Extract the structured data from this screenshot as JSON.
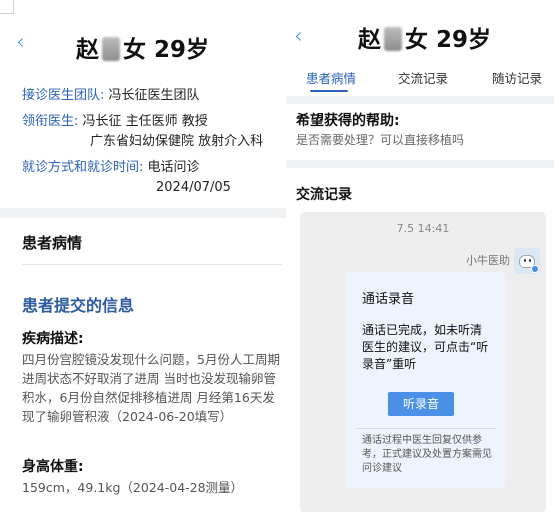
{
  "left": {
    "header": {
      "name_prefix": "赵",
      "title_rest": "女 29岁"
    },
    "team_label": "接诊医生团队:",
    "team_value": "冯长征医生团队",
    "lead_label": "领衔医生:",
    "lead_value": "冯长征 主任医师 教授",
    "lead_value2": "广东省妇幼保健院 放射介入科",
    "visit_label": "就诊方式和就诊时间:",
    "visit_value": "电话问诊",
    "visit_date": "2024/07/05",
    "section_title": "患者病情",
    "submitted_title": "患者提交的信息",
    "desc_title": "疾病描述:",
    "desc_text": "四月份宫腔镜没发现什么问题，5月份人工周期进周状态不好取消了进周 当时也没发现输卵管积水，6月份自然促排移植进周 月经第16天发现了输卵管积液（2024-06-20填写）",
    "hw_title": "身高体重:",
    "hw_text": "159cm，49.1kg（2024-04-28测量）"
  },
  "right": {
    "header": {
      "name_prefix": "赵",
      "title_rest": "女 29岁"
    },
    "tabs": [
      "患者病情",
      "交流记录",
      "随访记录"
    ],
    "help_title": "希望获得的帮助:",
    "help_text": "是否需要处理？可以直接移植吗",
    "chat_title": "交流记录",
    "chat_time": "7.5 14:41",
    "sender": "小牛医助",
    "card_title": "通话录音",
    "card_text": "通话已完成，如未听清医生的建议，可点击“听录音”重听",
    "listen_button": "听录音",
    "card_note": "通话过程中医生回复仅供参考，正式建议及处置方案需见问诊建议"
  },
  "colors": {
    "accent": "#2c63b8",
    "button": "#4a90e6",
    "card_bg": "#eef4fd"
  },
  "icons": {
    "back": "chevron-left-icon",
    "avatar": "assistant-avatar-icon"
  }
}
